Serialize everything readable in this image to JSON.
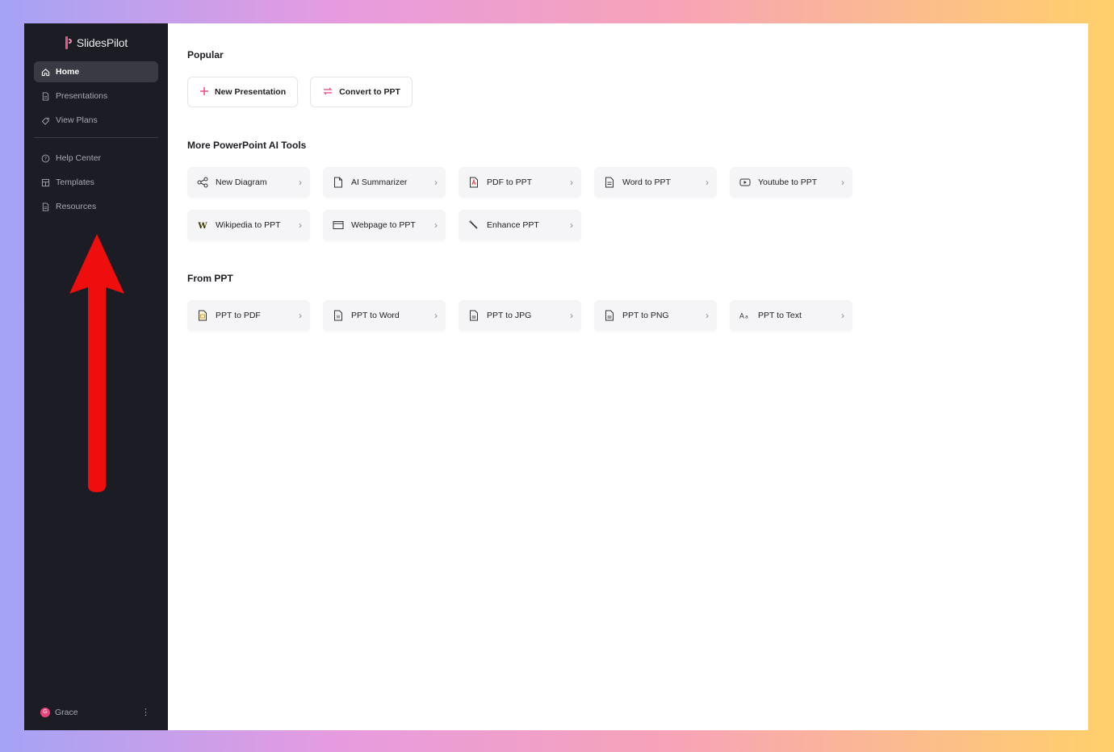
{
  "app": {
    "name": "SlidesPilot"
  },
  "sidebar": {
    "items": [
      {
        "label": "Home",
        "icon": "home-icon",
        "active": true
      },
      {
        "label": "Presentations",
        "icon": "file-icon"
      },
      {
        "label": "View Plans",
        "icon": "tag-icon"
      }
    ],
    "items2": [
      {
        "label": "Help Center",
        "icon": "help-icon"
      },
      {
        "label": "Templates",
        "icon": "grid-icon"
      },
      {
        "label": "Resources",
        "icon": "file-icon"
      }
    ],
    "user": {
      "initial": "G",
      "name": "Grace"
    }
  },
  "main": {
    "popular": {
      "title": "Popular",
      "buttons": [
        {
          "label": "New Presentation",
          "icon": "plus-icon"
        },
        {
          "label": "Convert to PPT",
          "icon": "convert-icon"
        }
      ]
    },
    "tools": {
      "title": "More PowerPoint AI Tools",
      "items": [
        {
          "label": "New Diagram",
          "icon": "diagram-icon"
        },
        {
          "label": "AI Summarizer",
          "icon": "document-icon"
        },
        {
          "label": "PDF to PPT",
          "icon": "pdf-icon"
        },
        {
          "label": "Word to PPT",
          "icon": "word-icon"
        },
        {
          "label": "Youtube to PPT",
          "icon": "youtube-icon"
        },
        {
          "label": "Wikipedia to PPT",
          "icon": "wikipedia-icon"
        },
        {
          "label": "Webpage to PPT",
          "icon": "webpage-icon"
        },
        {
          "label": "Enhance PPT",
          "icon": "magic-wand-icon"
        }
      ]
    },
    "from_ppt": {
      "title": "From PPT",
      "items": [
        {
          "label": "PPT to PDF",
          "icon": "pdf-file-icon"
        },
        {
          "label": "PPT to Word",
          "icon": "word-file-icon"
        },
        {
          "label": "PPT to JPG",
          "icon": "image-file-icon"
        },
        {
          "label": "PPT to PNG",
          "icon": "image-file-icon"
        },
        {
          "label": "PPT to Text",
          "icon": "text-icon"
        }
      ]
    }
  },
  "colors": {
    "sidebar_bg": "#1c1c24",
    "accent": "#e8447a",
    "arrow": "#ee0e0e"
  }
}
